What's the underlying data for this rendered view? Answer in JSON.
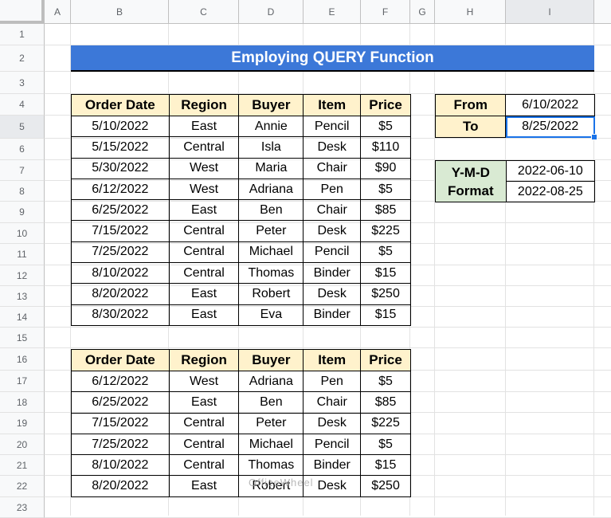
{
  "columns": [
    "A",
    "B",
    "C",
    "D",
    "E",
    "F",
    "G",
    "H",
    "I"
  ],
  "rows": [
    "1",
    "2",
    "3",
    "4",
    "5",
    "6",
    "7",
    "8",
    "9",
    "10",
    "11",
    "12",
    "13",
    "14",
    "15",
    "16",
    "17",
    "18",
    "19",
    "20",
    "21",
    "22",
    "23"
  ],
  "title": "Employing QUERY Function",
  "table1": {
    "headers": [
      "Order Date",
      "Region",
      "Buyer",
      "Item",
      "Price"
    ],
    "rows": [
      [
        "5/10/2022",
        "East",
        "Annie",
        "Pencil",
        "$5"
      ],
      [
        "5/15/2022",
        "Central",
        "Isla",
        "Desk",
        "$110"
      ],
      [
        "5/30/2022",
        "West",
        "Maria",
        "Chair",
        "$90"
      ],
      [
        "6/12/2022",
        "West",
        "Adriana",
        "Pen",
        "$5"
      ],
      [
        "6/25/2022",
        "East",
        "Ben",
        "Chair",
        "$85"
      ],
      [
        "7/15/2022",
        "Central",
        "Peter",
        "Desk",
        "$225"
      ],
      [
        "7/25/2022",
        "Central",
        "Michael",
        "Pencil",
        "$5"
      ],
      [
        "8/10/2022",
        "Central",
        "Thomas",
        "Binder",
        "$15"
      ],
      [
        "8/20/2022",
        "East",
        "Robert",
        "Desk",
        "$250"
      ],
      [
        "8/30/2022",
        "East",
        "Eva",
        "Binder",
        "$15"
      ]
    ]
  },
  "table2": {
    "headers": [
      "Order Date",
      "Region",
      "Buyer",
      "Item",
      "Price"
    ],
    "rows": [
      [
        "6/12/2022",
        "West",
        "Adriana",
        "Pen",
        "$5"
      ],
      [
        "6/25/2022",
        "East",
        "Ben",
        "Chair",
        "$85"
      ],
      [
        "7/15/2022",
        "Central",
        "Peter",
        "Desk",
        "$225"
      ],
      [
        "7/25/2022",
        "Central",
        "Michael",
        "Pencil",
        "$5"
      ],
      [
        "8/10/2022",
        "Central",
        "Thomas",
        "Binder",
        "$15"
      ],
      [
        "8/20/2022",
        "East",
        "Robert",
        "Desk",
        "$250"
      ]
    ]
  },
  "criteria": {
    "from_label": "From",
    "from_value": "6/10/2022",
    "to_label": "To",
    "to_value": "8/25/2022"
  },
  "ymd": {
    "label_line1": "Y-M-D",
    "label_line2": "Format",
    "from_value": "2022-06-10",
    "to_value": "2022-08-25"
  },
  "watermark": "OfficeWheel",
  "colors": {
    "banner": "#3c78d8",
    "header_fill": "#fff2cc",
    "ymd_fill": "#d9ead3",
    "selection": "#1a73e8"
  }
}
